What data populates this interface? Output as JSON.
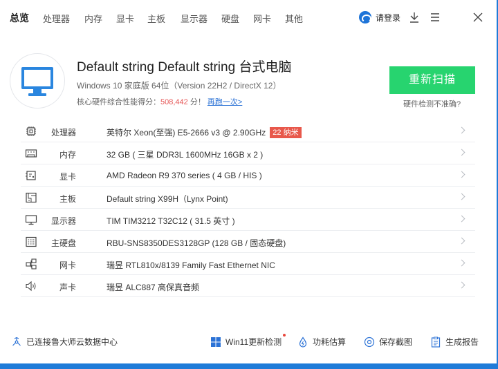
{
  "nav": {
    "tabs": [
      {
        "label": "总览",
        "active": true
      },
      {
        "label": "处理器"
      },
      {
        "label": "内存"
      },
      {
        "label": "显卡"
      },
      {
        "label": "主板"
      },
      {
        "label": "显示器"
      },
      {
        "label": "硬盘"
      },
      {
        "label": "网卡"
      },
      {
        "label": "其他"
      }
    ],
    "login_label": "请登录"
  },
  "summary": {
    "title": "Default string Default string 台式电脑",
    "subtitle": "Windows 10 家庭版 64位（Version 22H2 / DirectX 12）",
    "score_prefix": "核心硬件综合性能得分：",
    "score": "508,442",
    "score_suffix": " 分！",
    "rerun_label": "再跑一次>",
    "rescan_label": "重新扫描",
    "inaccurate_label": "硬件检测不准确?"
  },
  "hardware": [
    {
      "label": "处理器",
      "value": "英特尔 Xeon(至强) E5-2666 v3 @ 2.90GHz",
      "badge": "22 纳米",
      "icon": "cpu-icon"
    },
    {
      "label": "内存",
      "value": "32 GB ( 三星 DDR3L 1600MHz 16GB x 2 )",
      "icon": "memory-icon"
    },
    {
      "label": "显卡",
      "value": "AMD Radeon R9 370 series ( 4 GB / HIS )",
      "icon": "gpu-icon"
    },
    {
      "label": "主板",
      "value": "Default string X99H（Lynx Point)",
      "icon": "motherboard-icon"
    },
    {
      "label": "显示器",
      "value": "TIM TIM3212 T32C12 ( 31.5 英寸 )",
      "icon": "monitor-icon"
    },
    {
      "label": "主硬盘",
      "value": "RBU-SNS8350DES3128GP (128 GB / 固态硬盘)",
      "icon": "disk-icon"
    },
    {
      "label": "网卡",
      "value": "瑞昱 RTL810x/8139 Family Fast Ethernet NIC",
      "icon": "network-icon"
    },
    {
      "label": "声卡",
      "value": "瑞昱 ALC887 高保真音频",
      "icon": "speaker-icon"
    }
  ],
  "footer": {
    "cloud_status": "已连接鲁大师云数据中心",
    "win11_check": "Win11更新检测",
    "power_estimate": "功耗估算",
    "save_screenshot": "保存截图",
    "generate_report": "生成报告"
  },
  "colors": {
    "accent_green": "#27d46f",
    "score_red": "#e65656",
    "link_blue": "#2b72d6",
    "badge_red": "#e8584b",
    "window_blue": "#1f7bd8"
  }
}
